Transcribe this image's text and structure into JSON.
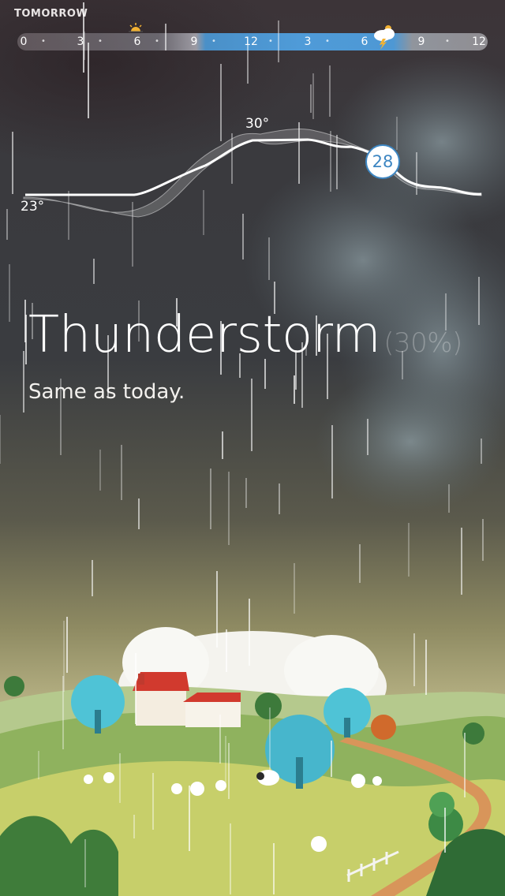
{
  "header": {
    "title": "TOMORROW"
  },
  "timeline": {
    "ticks": [
      "0",
      "•",
      "3",
      "•",
      "6",
      "•",
      "9",
      "•",
      "12",
      "•",
      "3",
      "•",
      "6",
      "•",
      "9",
      "•",
      "12"
    ],
    "icons": [
      "sun-icon",
      "thunderstorm-icon"
    ]
  },
  "temperature": {
    "low_label": "23°",
    "high_label": "30°",
    "current": "28"
  },
  "condition": {
    "name": "Thunderstorm",
    "chance": "(30%)",
    "summary": "Same as today."
  },
  "colors": {
    "accent": "#3d86c2",
    "timeline_active": "#4f9bd8"
  }
}
